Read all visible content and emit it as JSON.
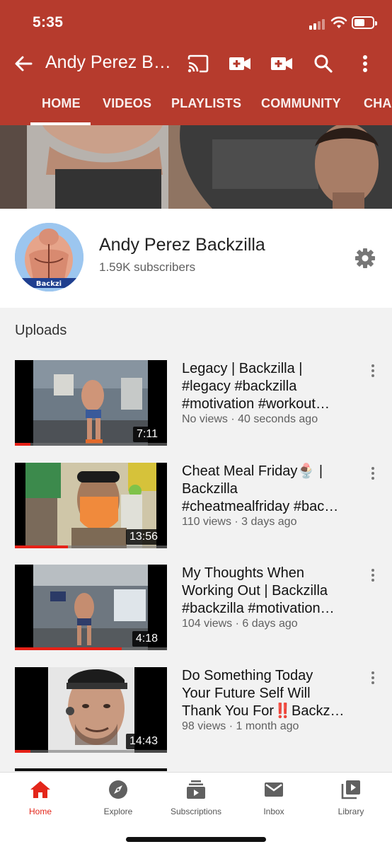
{
  "status_bar": {
    "time": "5:35"
  },
  "app_bar": {
    "back_icon": "arrow-back-icon",
    "title": "Andy Perez Ba...",
    "icons": [
      "cast-icon",
      "add-video-icon",
      "add-video-icon",
      "search-icon",
      "more-vertical-icon"
    ]
  },
  "tabs": [
    {
      "label": "HOME",
      "selected": true
    },
    {
      "label": "VIDEOS"
    },
    {
      "label": "PLAYLISTS"
    },
    {
      "label": "COMMUNITY"
    },
    {
      "label": "CHA"
    }
  ],
  "channel": {
    "name": "Andy Perez Backzilla",
    "subscribers": "1.59K subscribers",
    "avatar_text": "Backzi"
  },
  "uploads": {
    "heading": "Uploads",
    "videos": [
      {
        "title_lines": [
          "Legacy | Backzilla |",
          "#legacy #backzilla",
          "#motivation #workout…"
        ],
        "meta": "No views · 40 seconds ago",
        "duration": "7:11",
        "progress": 0.1
      },
      {
        "title_lines": [
          "Cheat Meal Friday🍨 |",
          "Backzilla",
          "#cheatmealfriday #bac…"
        ],
        "meta": "110 views · 3 days ago",
        "duration": "13:56",
        "progress": 0.35
      },
      {
        "title_lines": [
          "My Thoughts When",
          "Working Out | Backzilla",
          "#backzilla #motivation…"
        ],
        "meta": "104 views · 6 days ago",
        "duration": "4:18",
        "progress": 0.7
      },
      {
        "title_lines": [
          "Do Something Today",
          "Your Future Self Will",
          "Thank You For‼️Backz…"
        ],
        "meta": "98 views · 1 month ago",
        "duration": "14:43",
        "progress": 0.1
      }
    ]
  },
  "bottom_nav": [
    {
      "label": "Home",
      "icon": "home-icon",
      "active": true
    },
    {
      "label": "Explore",
      "icon": "compass-icon"
    },
    {
      "label": "Subscriptions",
      "icon": "subscriptions-icon"
    },
    {
      "label": "Inbox",
      "icon": "mail-icon"
    },
    {
      "label": "Library",
      "icon": "library-icon"
    }
  ],
  "colors": {
    "header": "#b63b2d",
    "accent_red": "#e3261a",
    "progress_red": "#e62117"
  }
}
